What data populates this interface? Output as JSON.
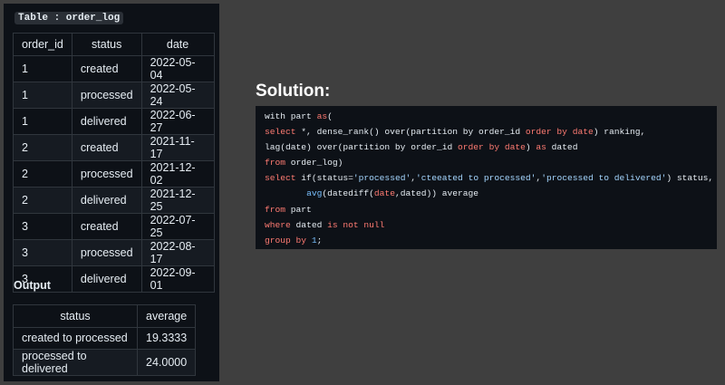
{
  "order_log": {
    "label": "Table : order_log",
    "headers": [
      "order_id",
      "status",
      "date"
    ],
    "rows": [
      [
        "1",
        "created",
        "2022-05-04"
      ],
      [
        "1",
        "processed",
        "2022-05-24"
      ],
      [
        "1",
        "delivered",
        "2022-06-27"
      ],
      [
        "2",
        "created",
        "2021-11-17"
      ],
      [
        "2",
        "processed",
        "2021-12-02"
      ],
      [
        "2",
        "delivered",
        "2021-12-25"
      ],
      [
        "3",
        "created",
        "2022-07-25"
      ],
      [
        "3",
        "processed",
        "2022-08-17"
      ],
      [
        "3",
        "delivered",
        "2022-09-01"
      ]
    ]
  },
  "output": {
    "label": "Output",
    "headers": [
      "status",
      "average"
    ],
    "rows": [
      [
        "created to processed",
        "19.3333"
      ],
      [
        "processed to delivered",
        "24.0000"
      ]
    ]
  },
  "solution": {
    "title": "Solution:",
    "code_lines": [
      [
        [
          "with part ",
          "plain"
        ],
        [
          "as",
          "kw"
        ],
        [
          "(",
          "plain"
        ]
      ],
      [
        [
          "select",
          "kw"
        ],
        [
          " *, dense_rank() over(partition by order_id ",
          "plain"
        ],
        [
          "order by date",
          "kw"
        ],
        [
          ") ranking,",
          "plain"
        ]
      ],
      [
        [
          "lag(date) over(partition by order_id ",
          "plain"
        ],
        [
          "order by date",
          "kw"
        ],
        [
          ") ",
          "plain"
        ],
        [
          "as",
          "kw"
        ],
        [
          " dated",
          "plain"
        ]
      ],
      [
        [
          "from",
          "kw"
        ],
        [
          " order_log)",
          "plain"
        ]
      ],
      [
        [
          "select",
          "kw"
        ],
        [
          " if(status=",
          "plain"
        ],
        [
          "'processed'",
          "st"
        ],
        [
          ",",
          "plain"
        ],
        [
          "'cteeated to processed'",
          "st"
        ],
        [
          ",",
          "plain"
        ],
        [
          "'processed to delivered'",
          "st"
        ],
        [
          ") status,",
          "plain"
        ]
      ],
      [
        [
          "        ",
          "plain"
        ],
        [
          "avg",
          "nm"
        ],
        [
          "(datediff(",
          "plain"
        ],
        [
          "date",
          "kw"
        ],
        [
          ",dated)) average",
          "plain"
        ]
      ],
      [
        [
          "from",
          "kw"
        ],
        [
          " part",
          "plain"
        ]
      ],
      [
        [
          "where",
          "kw"
        ],
        [
          " dated ",
          "plain"
        ],
        [
          "is not null",
          "kw"
        ]
      ],
      [
        [
          "group by",
          "kw"
        ],
        [
          " ",
          "plain"
        ],
        [
          "1",
          "nm"
        ],
        [
          ";",
          "plain"
        ]
      ]
    ]
  },
  "colors": {
    "background": "#3f3f3f",
    "panel": "#0d1117",
    "keyword": "#ff7b72",
    "string": "#a5d6ff",
    "number": "#79c0ff"
  }
}
